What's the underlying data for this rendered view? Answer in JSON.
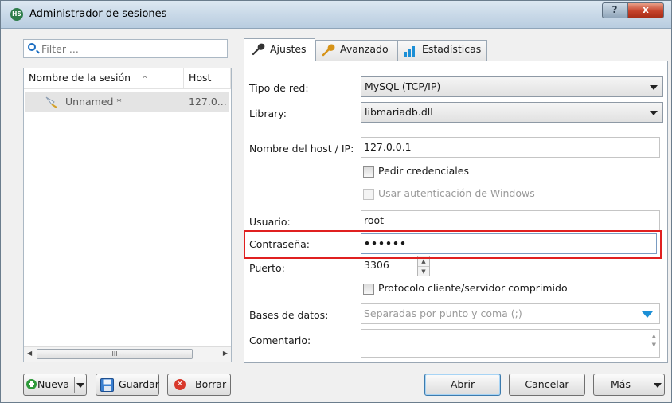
{
  "window": {
    "title": "Administrador de sesiones",
    "help_label": "?",
    "close_label": "x",
    "app_icon_text": "HS"
  },
  "sidebar": {
    "filter_placeholder": "Filter ...",
    "columns": [
      "Nombre de la sesión",
      "Host"
    ],
    "sessions": [
      {
        "name": "Unnamed *",
        "host": "127.0..."
      }
    ],
    "scroll_grip": "III"
  },
  "tabs": [
    {
      "label": "Ajustes",
      "icon": "wrench-icon",
      "active": true
    },
    {
      "label": "Avanzado",
      "icon": "wrench-icon",
      "active": false
    },
    {
      "label": "Estadísticas",
      "icon": "bar-chart-icon",
      "active": false
    }
  ],
  "form": {
    "network_type_label": "Tipo de red:",
    "network_type_value": "MySQL (TCP/IP)",
    "library_label": "Library:",
    "library_value": "libmariadb.dll",
    "host_label": "Nombre del host / IP:",
    "host_value": "127.0.0.1",
    "ask_credentials_label": "Pedir credenciales",
    "windows_auth_label": "Usar autenticación de Windows",
    "user_label": "Usuario:",
    "user_value": "root",
    "password_label": "Contraseña:",
    "password_value": "••••••",
    "port_label": "Puerto:",
    "port_value": "3306",
    "compression_label": "Protocolo cliente/servidor comprimido",
    "databases_label": "Bases de datos:",
    "databases_placeholder": "Separadas por punto y coma (;)",
    "comment_label": "Comentario:"
  },
  "buttons": {
    "new": "Nueva",
    "save": "Guardar",
    "delete": "Borrar",
    "open": "Abrir",
    "cancel": "Cancelar",
    "more": "Más"
  },
  "colors": {
    "highlight": "#e02020",
    "accent": "#1b6ec2"
  }
}
